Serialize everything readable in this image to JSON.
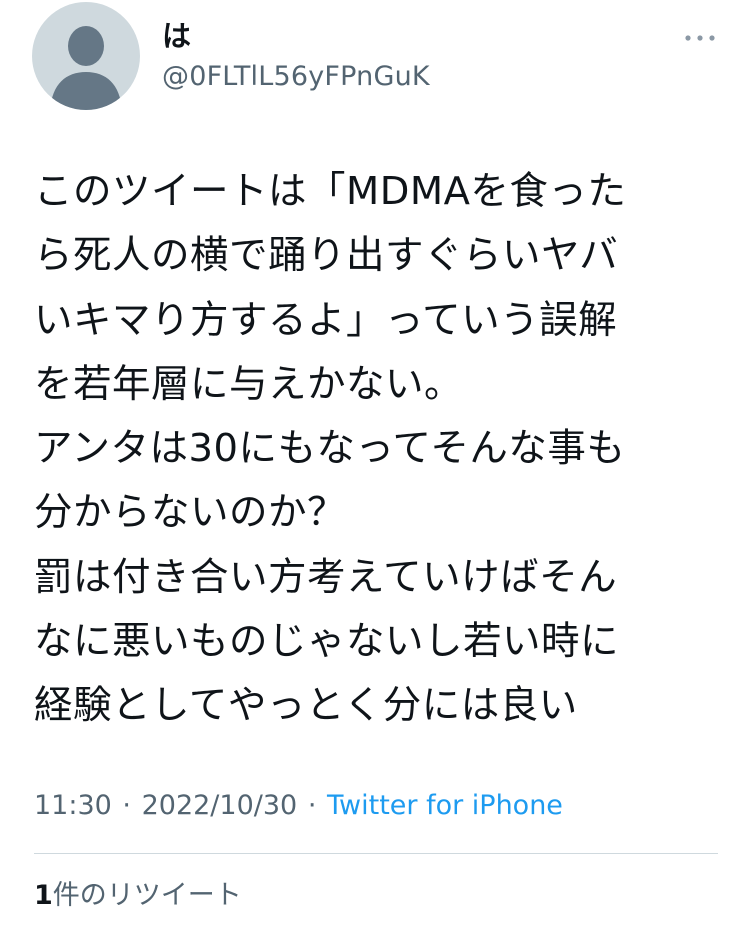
{
  "author": {
    "display_name": "は",
    "handle": "@0FLTlL56yFPnGuK",
    "avatar_icon": "default-profile-person-icon"
  },
  "tweet": {
    "text": "このツイートは「MDMAを食った\nら死人の横で踊り出すぐらいヤバ\nいキマり方するよ」っていう誤解\nを若年層に与えかない。\nアンタは30にもなってそんな事も\n分からないのか？\n罰は付き合い方考えていけばそん\nなに悪いものじゃないし若い時に\n経験としてやっとく分には良い"
  },
  "meta": {
    "time": "11:30",
    "separator": "·",
    "date": "2022/10/30",
    "source": "Twitter for iPhone"
  },
  "stats": {
    "retweet_count": "1",
    "retweet_label": "件のリツイート"
  },
  "icons": {
    "more": "more-horizontal-icon"
  },
  "colors": {
    "text_primary": "#0f1419",
    "text_secondary": "#536471",
    "link": "#1d9bf0",
    "avatar_bg": "#cfd9de",
    "avatar_fg": "#657786",
    "divider": "#cfd9de"
  }
}
